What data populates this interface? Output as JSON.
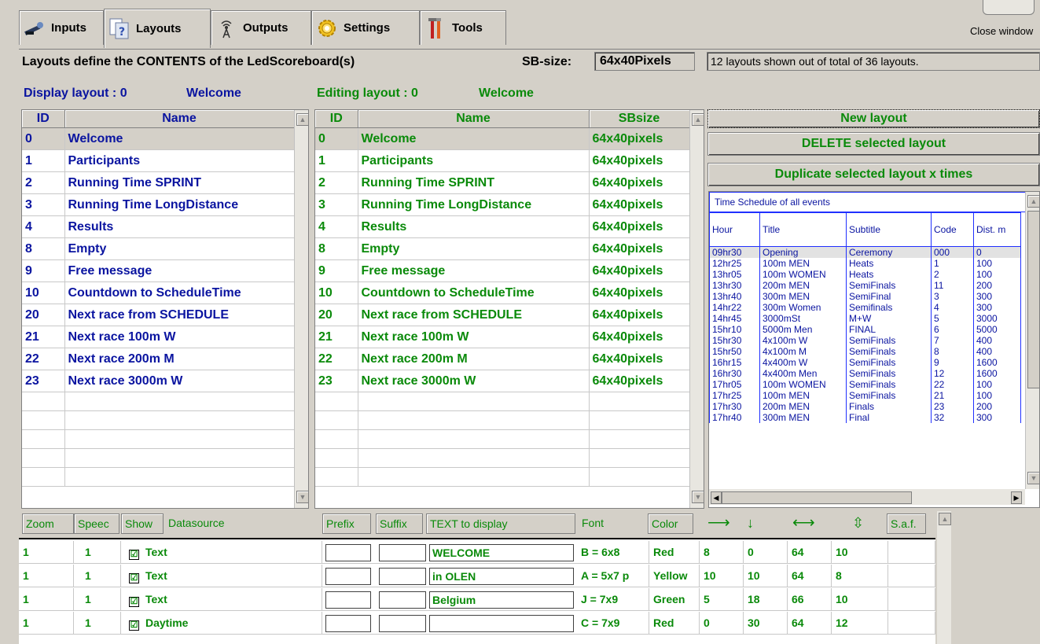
{
  "tabs": [
    {
      "label": "Inputs",
      "icon": "satellite-icon"
    },
    {
      "label": "Layouts",
      "icon": "help-document-icon"
    },
    {
      "label": "Outputs",
      "icon": "antenna-icon"
    },
    {
      "label": "Settings",
      "icon": "gear-icon"
    },
    {
      "label": "Tools",
      "icon": "tools-icon"
    }
  ],
  "close_window": "Close window",
  "header": {
    "title": "Layouts define the CONTENTS of the LedScoreboard(s)",
    "sb_size_label": "SB-size:",
    "sb_size_value": "64x40Pixels",
    "info": "12 layouts shown out of total of 36 layouts."
  },
  "display_layout": {
    "label": "Display layout : 0",
    "name": "Welcome"
  },
  "editing_layout": {
    "label": "Editing layout : 0",
    "name": "Welcome"
  },
  "display_grid": {
    "columns": [
      "ID",
      "Name"
    ],
    "rows": [
      [
        "0",
        "Welcome"
      ],
      [
        "1",
        "Participants"
      ],
      [
        "2",
        "Running Time SPRINT"
      ],
      [
        "3",
        "Running Time LongDistance"
      ],
      [
        "4",
        "Results"
      ],
      [
        "8",
        "Empty"
      ],
      [
        "9",
        "Free message"
      ],
      [
        "10",
        "Countdown to ScheduleTime"
      ],
      [
        "20",
        "Next race from SCHEDULE"
      ],
      [
        "21",
        "Next race 100m W"
      ],
      [
        "22",
        "Next race 200m M"
      ],
      [
        "23",
        "Next race 3000m W"
      ]
    ]
  },
  "editing_grid": {
    "columns": [
      "ID",
      "Name",
      "SBsize"
    ],
    "rows": [
      [
        "0",
        "Welcome",
        "64x40pixels"
      ],
      [
        "1",
        "Participants",
        "64x40pixels"
      ],
      [
        "2",
        "Running Time SPRINT",
        "64x40pixels"
      ],
      [
        "3",
        "Running Time LongDistance",
        "64x40pixels"
      ],
      [
        "4",
        "Results",
        "64x40pixels"
      ],
      [
        "8",
        "Empty",
        "64x40pixels"
      ],
      [
        "9",
        "Free message",
        "64x40pixels"
      ],
      [
        "10",
        "Countdown to ScheduleTime",
        "64x40pixels"
      ],
      [
        "20",
        "Next race from SCHEDULE",
        "64x40pixels"
      ],
      [
        "21",
        "Next race 100m W",
        "64x40pixels"
      ],
      [
        "22",
        "Next race 200m M",
        "64x40pixels"
      ],
      [
        "23",
        "Next race 3000m W",
        "64x40pixels"
      ]
    ]
  },
  "buttons": {
    "new_layout": "New layout",
    "delete_layout": "DELETE selected layout",
    "duplicate_layout": "Duplicate selected layout x times"
  },
  "schedule": {
    "title": "Time Schedule of all events",
    "columns": [
      "Hour",
      "Title",
      "Subtitle",
      "Code",
      "Dist. m"
    ],
    "rows": [
      [
        "09hr30",
        "Opening",
        "Ceremony",
        "000",
        "0"
      ],
      [
        "12hr25",
        "100m MEN",
        "Heats",
        "1",
        "100"
      ],
      [
        "13hr05",
        "100m WOMEN",
        "Heats",
        "2",
        "100"
      ],
      [
        "13hr30",
        "200m MEN",
        "SemiFinals",
        "11",
        "200"
      ],
      [
        "13hr40",
        "300m MEN",
        "SemiFinal",
        "3",
        "300"
      ],
      [
        "14hr22",
        "300m Women",
        "Semifinals",
        "4",
        "300"
      ],
      [
        "14hr45",
        "3000mSt",
        "M+W",
        "5",
        "3000"
      ],
      [
        "15hr10",
        "5000m Men",
        "FINAL",
        "6",
        "5000"
      ],
      [
        "15hr30",
        "4x100m W",
        "SemiFinals",
        "7",
        "400"
      ],
      [
        "15hr50",
        "4x100m M",
        "SemiFinals",
        "8",
        "400"
      ],
      [
        "16hr15",
        "4x400m W",
        "SemiFinals",
        "9",
        "1600"
      ],
      [
        "16hr30",
        "4x400m Men",
        "SemiFinals",
        "12",
        "1600"
      ],
      [
        "17hr05",
        "100m WOMEN",
        "SemiFinals",
        "22",
        "100"
      ],
      [
        "17hr25",
        "100m MEN",
        "SemiFinals",
        "21",
        "100"
      ],
      [
        "17hr30",
        "200m MEN",
        "Finals",
        "23",
        "200"
      ],
      [
        "17hr40",
        "300m MEN",
        "Final",
        "32",
        "300"
      ]
    ]
  },
  "bottom": {
    "headers": {
      "zoom": "Zoom",
      "speed": "Speec",
      "show": "Show",
      "datasource": "Datasource",
      "prefix": "Prefix",
      "suffix": "Suffix",
      "text": "TEXT to display",
      "font": "Font",
      "color": "Color",
      "right": "⟶",
      "down": "↓",
      "width": "⟷",
      "height": "⇳",
      "saf": "S.a.f."
    },
    "rows": [
      {
        "zoom": "1",
        "speed": "1",
        "show": "☑",
        "source": "Text",
        "prefix": "",
        "suffix": "",
        "text": "WELCOME",
        "font": "B = 6x8",
        "color": "Red",
        "x": "8",
        "y": "0",
        "w": "64",
        "h": "10"
      },
      {
        "zoom": "1",
        "speed": "1",
        "show": "☑",
        "source": "Text",
        "prefix": "",
        "suffix": "",
        "text": "in OLEN",
        "font": "A = 5x7 p",
        "color": "Yellow",
        "x": "10",
        "y": "10",
        "w": "64",
        "h": "8"
      },
      {
        "zoom": "1",
        "speed": "1",
        "show": "☑",
        "source": "Text",
        "prefix": "",
        "suffix": "",
        "text": "Belgium",
        "font": "J = 7x9",
        "color": "Green",
        "x": "5",
        "y": "18",
        "w": "66",
        "h": "10"
      },
      {
        "zoom": "1",
        "speed": "1",
        "show": "☑",
        "source": "Daytime",
        "prefix": "",
        "suffix": "",
        "text": "",
        "font": "C = 7x9",
        "color": "Red",
        "x": "0",
        "y": "30",
        "w": "64",
        "h": "12"
      }
    ]
  },
  "colors": {
    "blue_text": "#0a14a0",
    "green_text": "#0a8a0a",
    "window_bg": "#d4d0c8",
    "schedule_border": "#2030ff"
  }
}
